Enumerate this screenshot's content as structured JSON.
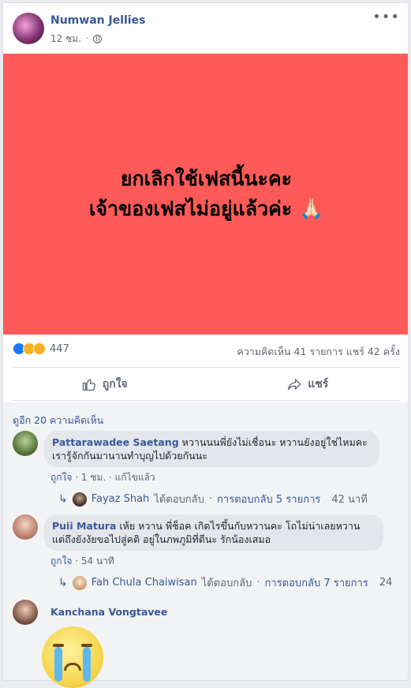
{
  "post": {
    "author": "Numwan Jellies",
    "time": "12 ชม.",
    "privacy_icon": "globe-icon",
    "banner_color": "#ff5a58",
    "banner_lines": [
      "ยกเลิกใช้เฟสนี้นะคะ",
      "เจ้าของเฟสไม่อยู่แล้วค่ะ 🙏🏻"
    ]
  },
  "stats": {
    "reaction_icons": [
      "like-icon",
      "sad-icon",
      "haha-icon"
    ],
    "reaction_count": "447",
    "comments_shares": "ความคิดเห็น 41 รายการ  แชร์ 42 ครั้ง"
  },
  "actions": {
    "like_label": "ถูกใจ",
    "share_label": "แชร์"
  },
  "comments": {
    "view_more": "ดูอีก 20 ความคิดเห็น",
    "items": [
      {
        "name": "Pattarawadee Saetang",
        "text": "หวานนนพี่ยังไม่เชื่อนะ หวานยังอยู่ใช่ไหมคะ เรารู้จักกันมานานทำบุญไปด้วยกันนะ",
        "like": "ถูกใจ",
        "time": "1 ชม.",
        "edited": "แก้ไขแล้ว",
        "reply_name": "Fayaz Shah",
        "reply_action": "ได้ตอบกลับ",
        "reply_count": "การตอบกลับ 5 รายการ",
        "reply_time": "42 นาที"
      },
      {
        "name": "Puii Matura",
        "text": "เห้ย หวาน พี่ช็อค เกิดไรขึ้นกับหวานคะ โถไม่น่าเลยหวาน แต่ถึงยังงัยขอไปสู่คติ อยู่ในภพภูมิที่ดีนะ รักน้องเสมอ",
        "like": "ถูกใจ",
        "time": "54 นาที",
        "reply_name": "Fah Chula Chaiwisan",
        "reply_action": "ได้ตอบกลับ",
        "reply_count": "การตอบกลับ 7 รายการ",
        "reply_time": "24"
      },
      {
        "name": "Kanchana Vongtavee"
      }
    ]
  }
}
